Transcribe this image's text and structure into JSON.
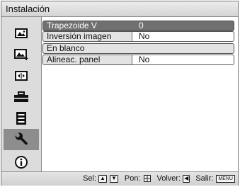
{
  "window": {
    "title": "Instalación"
  },
  "sidebar": {
    "items": [
      {
        "icon": "picture-icon",
        "selected": false
      },
      {
        "icon": "advanced-picture-icon",
        "selected": false
      },
      {
        "icon": "screen-icon",
        "selected": false
      },
      {
        "icon": "setup-icon",
        "selected": false
      },
      {
        "icon": "menu-setup-icon",
        "selected": false
      },
      {
        "icon": "wrench-icon",
        "selected": true
      },
      {
        "icon": "information-icon",
        "selected": false
      }
    ]
  },
  "menu": {
    "rows": [
      {
        "label": "Trapezoide V",
        "value": "0",
        "selected": true
      },
      {
        "label": "Inversión imagen",
        "value": "No",
        "selected": false
      },
      {
        "label": "En blanco",
        "value": "",
        "selected": false
      },
      {
        "label": "Alineac. panel",
        "value": "No",
        "selected": false
      }
    ]
  },
  "status": {
    "sel_label": "Sel:",
    "pon_label": "Pon:",
    "volver_label": "Volver:",
    "salir_label": "Salir:",
    "menu_key": "MENU"
  },
  "colors": {
    "selected_row": "#707070",
    "selected_icon": "#8d8d8d"
  }
}
